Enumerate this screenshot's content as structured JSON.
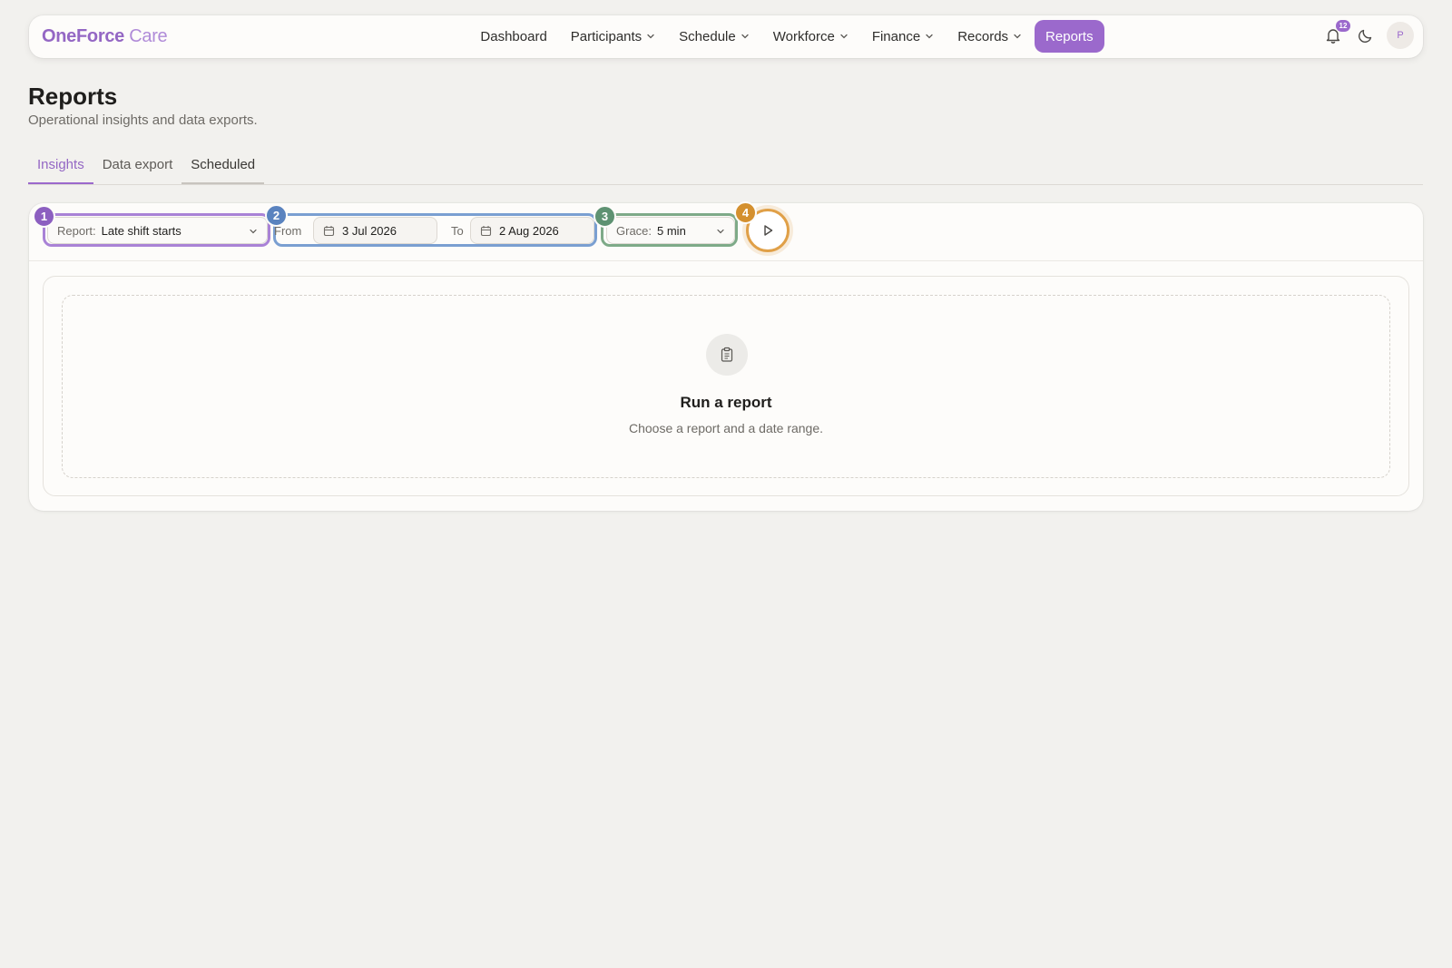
{
  "brand": {
    "primary": "OneForce",
    "secondary": "Care"
  },
  "nav": {
    "items": [
      {
        "label": "Dashboard",
        "has_menu": false
      },
      {
        "label": "Participants",
        "has_menu": true
      },
      {
        "label": "Schedule",
        "has_menu": true
      },
      {
        "label": "Workforce",
        "has_menu": true
      },
      {
        "label": "Finance",
        "has_menu": true
      },
      {
        "label": "Records",
        "has_menu": true
      },
      {
        "label": "Reports",
        "has_menu": false,
        "active": true
      }
    ],
    "notifications_count": "12",
    "avatar_initial": "P"
  },
  "header": {
    "title": "Reports",
    "subtitle": "Operational insights and data exports."
  },
  "tabs": [
    {
      "label": "Insights",
      "active": true
    },
    {
      "label": "Data export"
    },
    {
      "label": "Scheduled"
    }
  ],
  "toolbar": {
    "steps": [
      "1",
      "2",
      "3",
      "4"
    ],
    "report_label": "Report:",
    "report_value": "Late shift starts",
    "from_label": "From",
    "from_value": "3 Jul 2026",
    "to_label": "To",
    "to_value": "2 Aug 2026",
    "grace_label": "Grace:",
    "grace_value": "5 min"
  },
  "empty_state": {
    "title": "Run a report",
    "subtitle": "Choose a report and a date range."
  },
  "colors": {
    "accent": "#9b69cc",
    "step1": "#8c5fc0",
    "step2": "#5a83bf",
    "step3": "#5e9272",
    "step4": "#d4902f"
  }
}
